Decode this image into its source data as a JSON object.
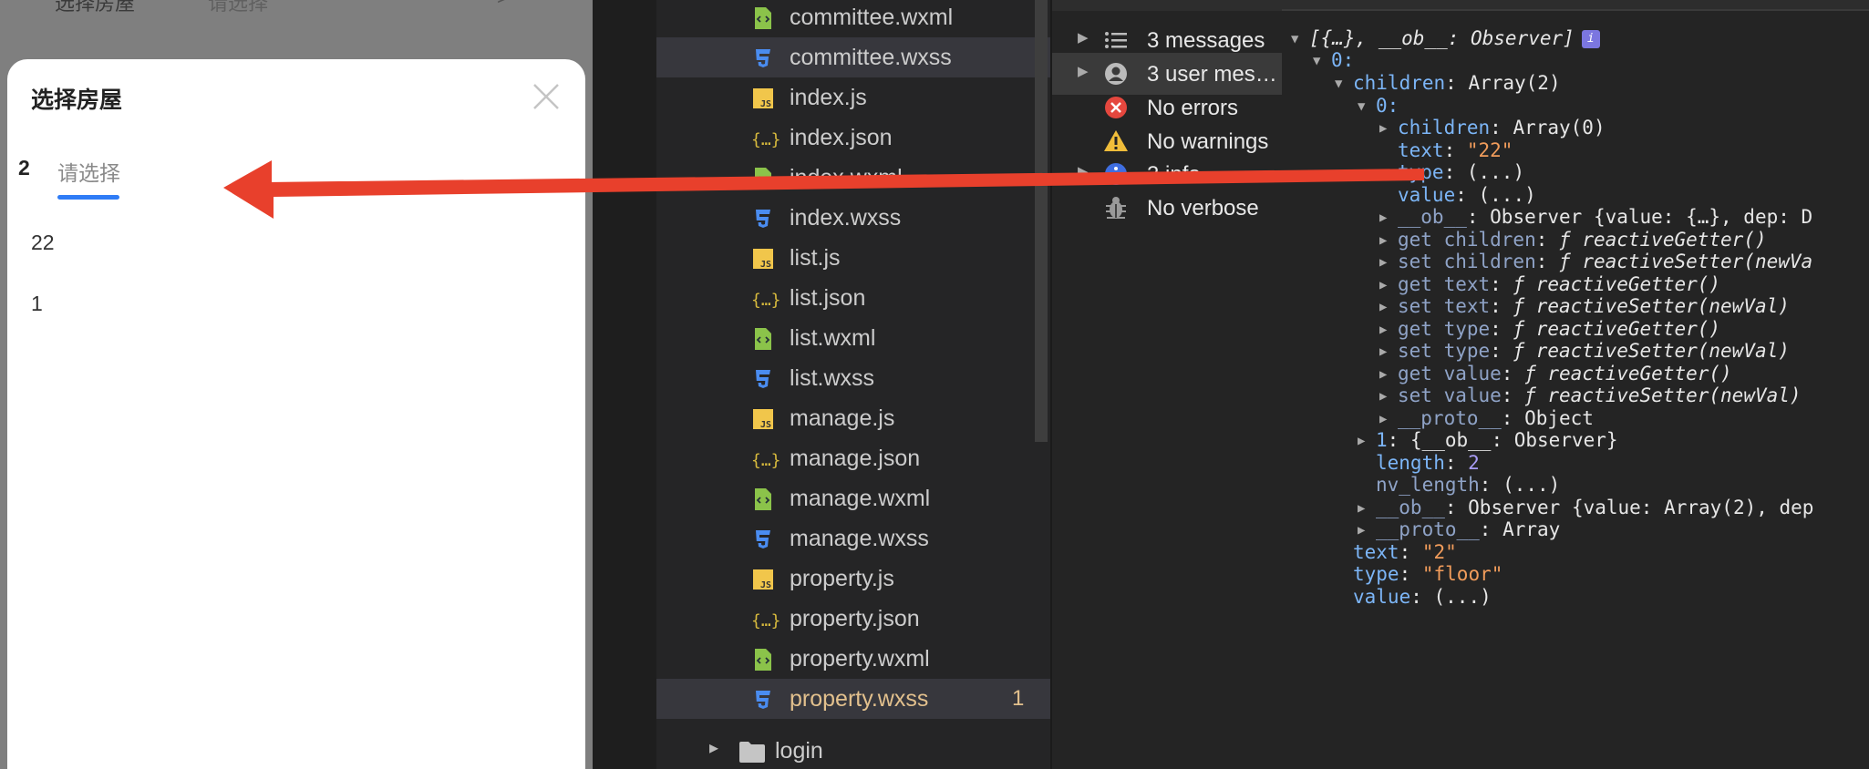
{
  "phone": {
    "top_field_label": "选择房屋",
    "top_field_placeholder": "请选择",
    "top_field_chevron": ">",
    "sheet": {
      "title": "选择房屋",
      "selected_tab": "2",
      "current_tab": "请选择",
      "options": [
        "22",
        "1"
      ]
    }
  },
  "explorer": {
    "files": [
      {
        "name": "committee.wxml",
        "type": "wxml"
      },
      {
        "name": "committee.wxss",
        "type": "wxss",
        "highlighted": true
      },
      {
        "name": "index.js",
        "type": "js"
      },
      {
        "name": "index.json",
        "type": "json"
      },
      {
        "name": "index.wxml",
        "type": "wxml"
      },
      {
        "name": "index.wxss",
        "type": "wxss"
      },
      {
        "name": "list.js",
        "type": "js"
      },
      {
        "name": "list.json",
        "type": "json"
      },
      {
        "name": "list.wxml",
        "type": "wxml"
      },
      {
        "name": "list.wxss",
        "type": "wxss"
      },
      {
        "name": "manage.js",
        "type": "js"
      },
      {
        "name": "manage.json",
        "type": "json"
      },
      {
        "name": "manage.wxml",
        "type": "wxml"
      },
      {
        "name": "manage.wxss",
        "type": "wxss"
      },
      {
        "name": "property.js",
        "type": "js"
      },
      {
        "name": "property.json",
        "type": "json"
      },
      {
        "name": "property.wxml",
        "type": "wxml"
      },
      {
        "name": "property.wxss",
        "type": "wxss",
        "modified": true,
        "badge": "1"
      }
    ],
    "folder": "login",
    "colors": {
      "js": "#f1c64b",
      "json": "#d7ba3d",
      "wxml": "#8bc34a",
      "wxss": "#4a8cf0",
      "modified": "#e2c08d"
    }
  },
  "console_sidebar": {
    "items": [
      {
        "label": "3 messages",
        "icon": "list-icon"
      },
      {
        "label": "3 user mes…",
        "icon": "user-icon"
      },
      {
        "label": "No errors",
        "icon": "error-icon"
      },
      {
        "label": "No warnings",
        "icon": "warning-icon"
      },
      {
        "label": "3 info",
        "icon": "info-icon"
      },
      {
        "label": "No verbose",
        "icon": "bug-icon"
      }
    ]
  },
  "inspector": {
    "root": "[{…}, __ob__: Observer]",
    "idx0": "0:",
    "children_key": "children",
    "children_val": "Array(2)",
    "c0_idx": "0:",
    "c0_children_key": "children",
    "c0_children_val": "Array(0)",
    "text_key": "text",
    "text_val": "\"22\"",
    "type_key": "type",
    "type_val": "(...)",
    "value_key": "value",
    "value_val": "(...)",
    "ob_key": "__ob__",
    "ob_val": "Observer {value: {…}, dep: D",
    "get_children": "get children",
    "get_children_val": "reactiveGetter()",
    "set_children": "set children",
    "set_children_val": "reactiveSetter(newVa",
    "get_text": "get text",
    "get_text_val": "reactiveGetter()",
    "set_text": "set text",
    "set_text_val": "reactiveSetter(newVal)",
    "get_type": "get type",
    "get_type_val": "reactiveGetter()",
    "set_type": "set type",
    "set_type_val": "reactiveSetter(newVal)",
    "get_value": "get value",
    "get_value_val": "reactiveGetter()",
    "set_value": "set value",
    "set_value_val": "reactiveSetter(newVal)",
    "proto_key": "__proto__",
    "proto_val": "Object",
    "c1_idx": "1",
    "c1_val": "{__ob__: Observer}",
    "length_key": "length",
    "length_val": "2",
    "nvlength_key": "nv_length",
    "nvlength_val": "(...)",
    "ob2_key": "__ob__",
    "ob2_val": "Observer {value: Array(2), dep",
    "proto2_key": "__proto__",
    "proto2_val": "Array",
    "text2_key": "text",
    "text2_val": "\"2\"",
    "type2_key": "type",
    "type2_val": "\"floor\"",
    "value2_key": "value",
    "value2_val": "(...)"
  },
  "annotation": {
    "arrow_color": "#e8402c"
  }
}
